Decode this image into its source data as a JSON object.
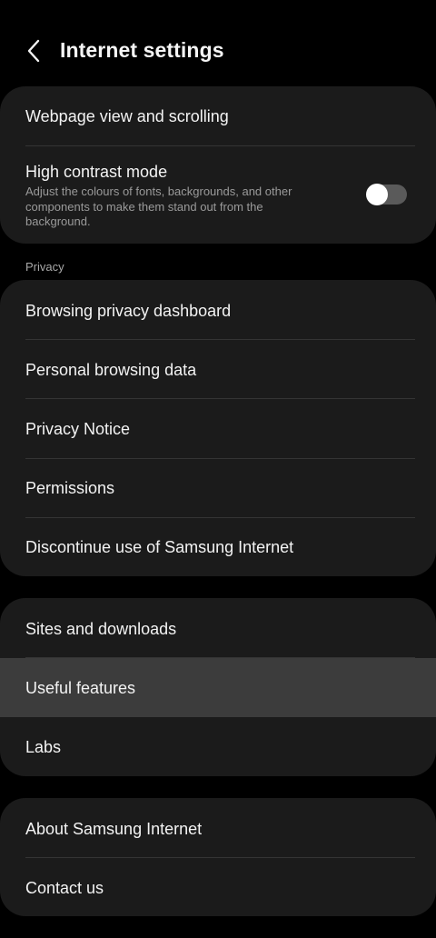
{
  "header": {
    "title": "Internet settings"
  },
  "display_card": {
    "webpage_view": "Webpage view and scrolling",
    "high_contrast": {
      "title": "High contrast mode",
      "description": "Adjust the colours of fonts, backgrounds, and other components to make them stand out from the background.",
      "enabled": false
    }
  },
  "privacy": {
    "section_label": "Privacy",
    "items": [
      "Browsing privacy dashboard",
      "Personal browsing data",
      "Privacy Notice",
      "Permissions",
      "Discontinue use of Samsung Internet"
    ]
  },
  "features_card": {
    "items": [
      "Sites and downloads",
      "Useful features",
      "Labs"
    ],
    "highlighted_item": "Useful features"
  },
  "about_card": {
    "items": [
      "About Samsung Internet",
      "Contact us"
    ]
  },
  "icons": {
    "back": "chevron-left-icon"
  },
  "colors": {
    "background": "#000000",
    "card": "#1b1b1b",
    "highlight": "#3c3c3c",
    "toggle_off": "#5a5a5a"
  }
}
